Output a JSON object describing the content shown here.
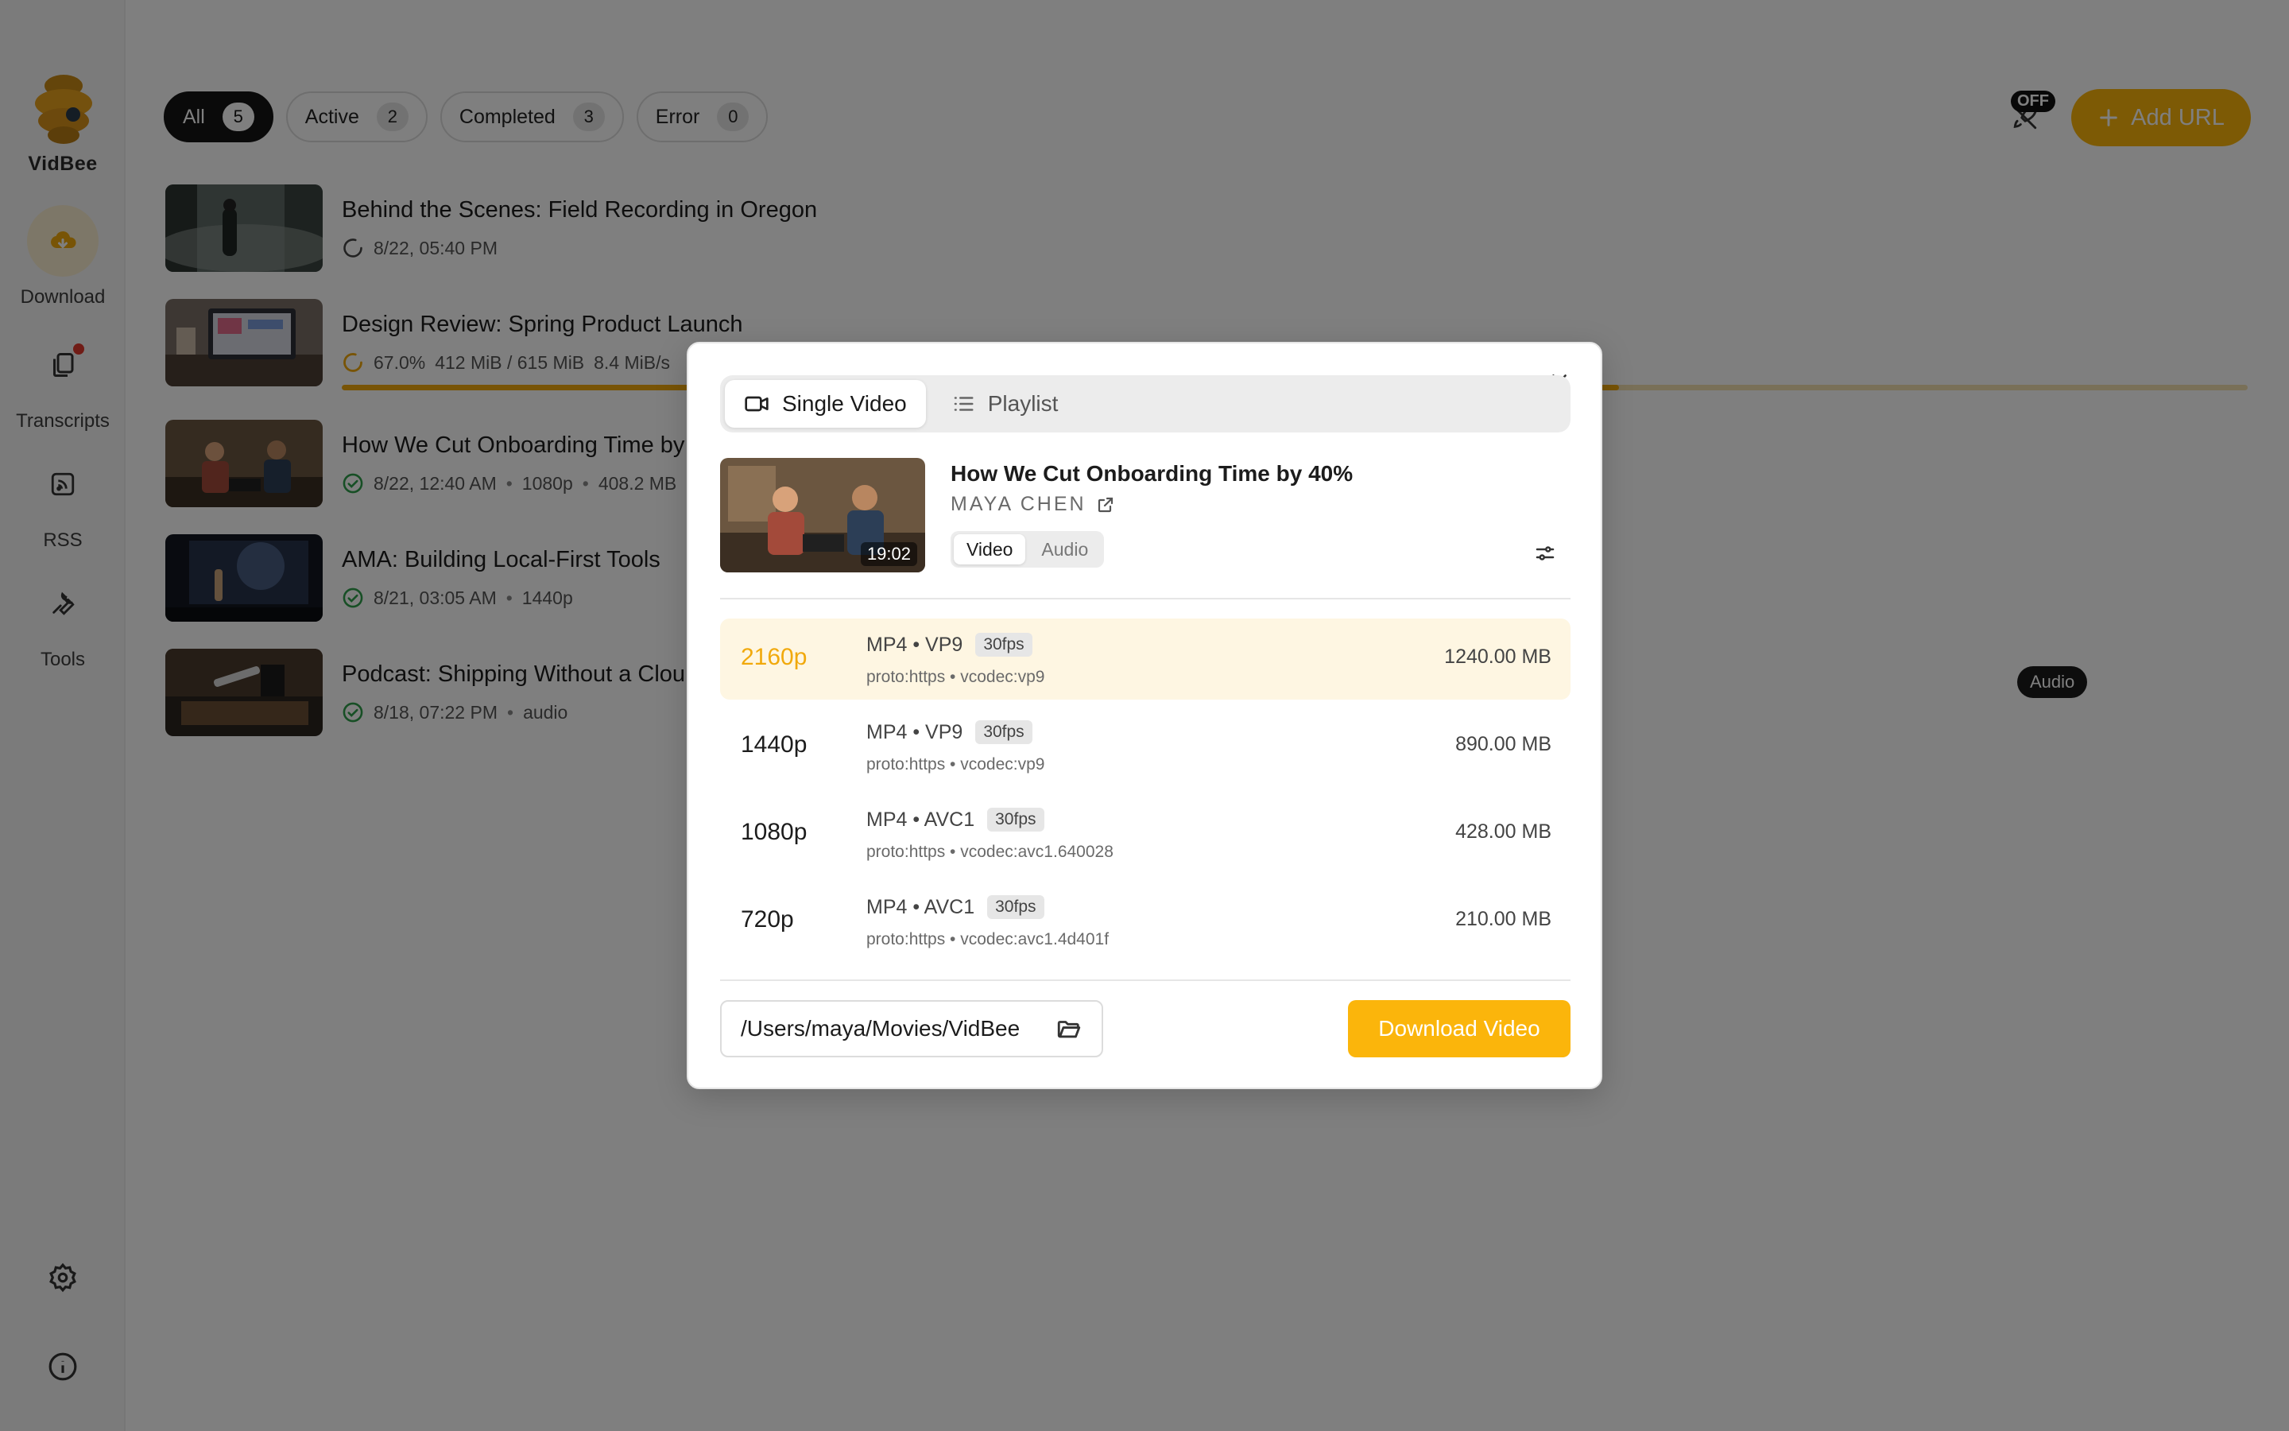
{
  "app": {
    "name": "VidBee"
  },
  "sidebar": {
    "items": [
      {
        "label": "Download",
        "icon": "download-cloud-icon",
        "active": true
      },
      {
        "label": "Transcripts",
        "icon": "transcripts-icon",
        "has_badge": true
      },
      {
        "label": "RSS",
        "icon": "rss-icon"
      },
      {
        "label": "Tools",
        "icon": "wrench-icon"
      }
    ],
    "bottom_icons": [
      "settings-icon",
      "info-icon"
    ]
  },
  "filters": [
    {
      "label": "All",
      "count": "5",
      "active": true
    },
    {
      "label": "Active",
      "count": "2"
    },
    {
      "label": "Completed",
      "count": "3"
    },
    {
      "label": "Error",
      "count": "0"
    }
  ],
  "header": {
    "auto_badge": "OFF",
    "add_url_label": "Add URL"
  },
  "downloads": [
    {
      "title": "Behind the Scenes: Field Recording in Oregon",
      "status": "pending",
      "meta": [
        "8/22, 05:40 PM"
      ]
    },
    {
      "title": "Design Review: Spring Product Launch",
      "status": "downloading",
      "meta": [
        "67.0%",
        "412 MiB / 615 MiB",
        "8.4 MiB/s"
      ],
      "progress": 0.67
    },
    {
      "title": "How We Cut Onboarding Time by",
      "status": "completed",
      "meta": [
        "8/22, 12:40 AM",
        "1080p",
        "408.2 MB"
      ]
    },
    {
      "title": "AMA: Building Local-First Tools",
      "status": "completed",
      "meta": [
        "8/21, 03:05 AM",
        "1440p"
      ]
    },
    {
      "title": "Podcast: Shipping Without a Clou",
      "status": "completed",
      "meta": [
        "8/18, 07:22 PM",
        "audio"
      ],
      "tag": "Audio"
    }
  ],
  "dialog": {
    "tabs": [
      "Single Video",
      "Playlist"
    ],
    "active_tab": "Single Video",
    "video": {
      "title": "How We Cut Onboarding Time by 40%",
      "author": "MAYA CHEN",
      "duration": "19:02"
    },
    "type_toggle": [
      "Video",
      "Audio"
    ],
    "active_type": "Video",
    "formats": [
      {
        "res": "2160p",
        "codec": "MP4 • VP9",
        "fps": "30fps",
        "detail": "proto:https • vcodec:vp9",
        "size": "1240.00 MB",
        "selected": true
      },
      {
        "res": "1440p",
        "codec": "MP4 • VP9",
        "fps": "30fps",
        "detail": "proto:https • vcodec:vp9",
        "size": "890.00 MB"
      },
      {
        "res": "1080p",
        "codec": "MP4 • AVC1",
        "fps": "30fps",
        "detail": "proto:https • vcodec:avc1.640028",
        "size": "428.00 MB"
      },
      {
        "res": "720p",
        "codec": "MP4 • AVC1",
        "fps": "30fps",
        "detail": "proto:https • vcodec:avc1.4d401f",
        "size": "210.00 MB"
      }
    ],
    "save_path": "/Users/maya/Movies/VidBee",
    "download_label": "Download Video"
  },
  "colors": {
    "accent": "#fbb50b",
    "success": "#2e9e4a",
    "badge": "#e0382c"
  }
}
